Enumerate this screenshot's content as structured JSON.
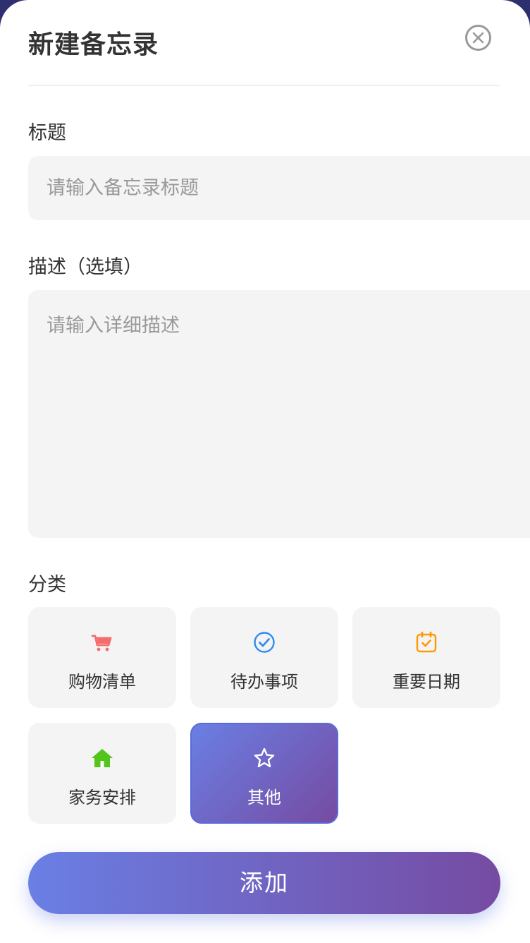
{
  "header": {
    "title": "新建备忘录"
  },
  "form": {
    "title_label": "标题",
    "title_placeholder": "请输入备忘录标题",
    "title_value": "",
    "desc_label": "描述（选填）",
    "desc_placeholder": "请输入详细描述",
    "desc_value": "",
    "category_label": "分类"
  },
  "categories": [
    {
      "label": "购物清单",
      "icon": "shopping-cart-icon",
      "color": "#f56c6c",
      "selected": false
    },
    {
      "label": "待办事项",
      "icon": "check-circle-icon",
      "color": "#2d8cf0",
      "selected": false
    },
    {
      "label": "重要日期",
      "icon": "calendar-check-icon",
      "color": "#ff9900",
      "selected": false
    },
    {
      "label": "家务安排",
      "icon": "home-icon",
      "color": "#52c41a",
      "selected": false
    },
    {
      "label": "其他",
      "icon": "star-icon",
      "color": "#ffffff",
      "selected": true
    }
  ],
  "actions": {
    "submit_label": "添加"
  },
  "theme": {
    "gradient_start": "#6a7fe4",
    "gradient_end": "#764ba2",
    "field_bg": "#f4f4f4"
  }
}
